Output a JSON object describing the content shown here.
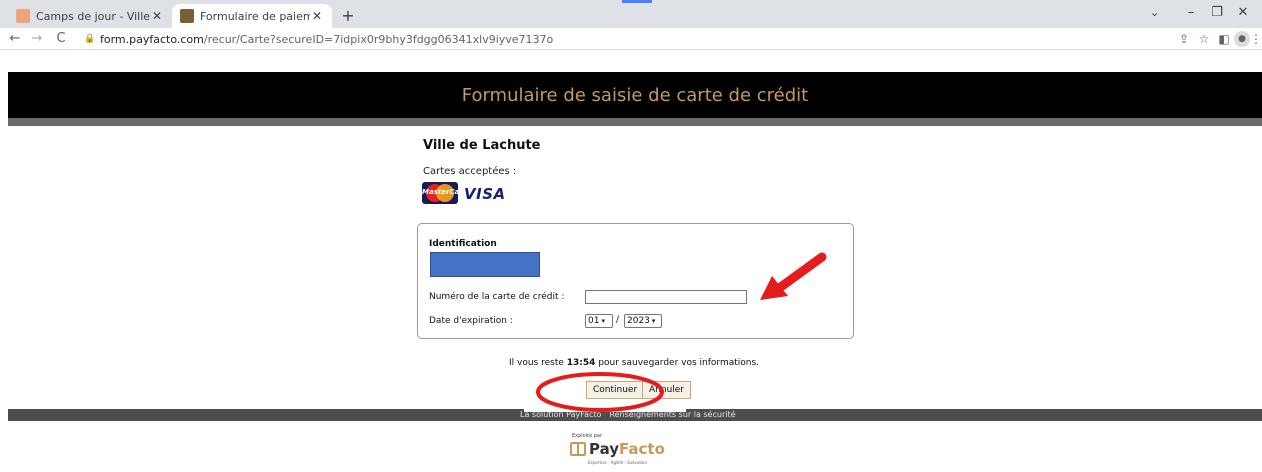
{
  "browser": {
    "tabs": [
      {
        "title": "Camps de jour - Ville de Lachute",
        "active": false
      },
      {
        "title": "Formulaire de paiement sécurisé",
        "active": true
      }
    ],
    "url_host": "form.payfacto.com",
    "url_path": "/recur/Carte?secureID=7idpix0r9bhy3fdgg06341xlv9iyve7137o"
  },
  "page": {
    "header_title": "Formulaire de saisie de carte de crédit",
    "merchant": "Ville de Lachute",
    "accepted_cards_label": "Cartes acceptées :",
    "mastercard_text": "MasterCard",
    "visa_text": "VISA",
    "identification_label": "Identification",
    "cc_number_label": "Numéro de la carte de crédit :",
    "cc_number_value": "",
    "expiration_label": "Date d'expiration :",
    "exp_month": "01",
    "exp_separator": "/",
    "exp_year": "2023",
    "timer_prefix": "Il vous reste",
    "timer_value": "13:54",
    "timer_suffix": "pour sauvegarder vos informations.",
    "continue_label": "Continuer",
    "cancel_label": "Annuler"
  },
  "footer": {
    "link_solution": "La solution PayFacto",
    "link_security": "Renseignements sur la sécurité",
    "operated_by": "Exploité par",
    "brand_pay": "Pay",
    "brand_facto": "Facto",
    "tagline": "Expertise - Agilité - Exécution"
  },
  "colors": {
    "header_bg": "#000000",
    "header_text": "#c49a5e",
    "annotation_red": "#e51c1c",
    "redaction_blue": "#4472c4"
  }
}
